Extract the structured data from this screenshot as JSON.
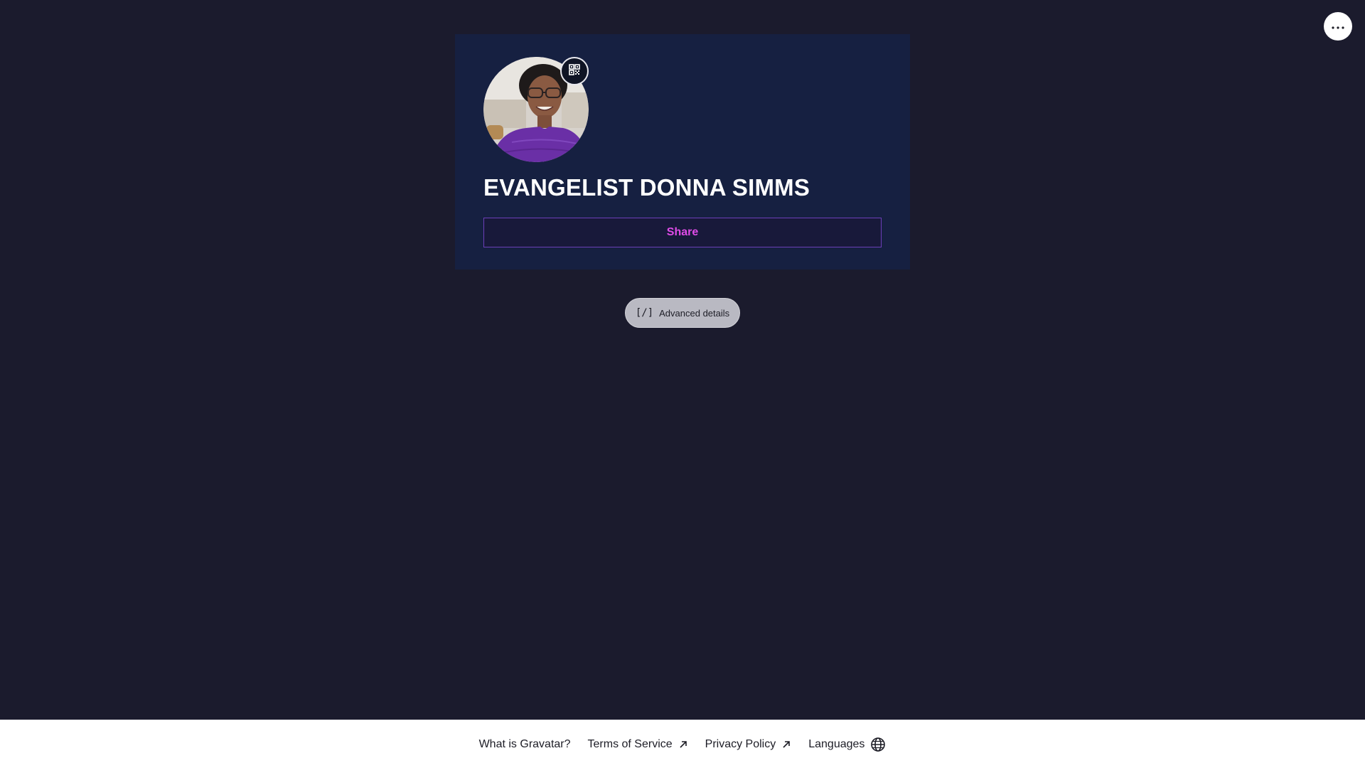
{
  "profile": {
    "name": "EVANGELIST DONNA SIMMS"
  },
  "card": {
    "share_label": "Share"
  },
  "advanced": {
    "label": "Advanced details",
    "icon_text": "[/]"
  },
  "footer": {
    "links": [
      {
        "label": "What is Gravatar?"
      },
      {
        "label": "Terms of Service"
      },
      {
        "label": "Privacy Policy"
      },
      {
        "label": "Languages"
      }
    ]
  },
  "colors": {
    "background": "#1b1b2d",
    "card": "#162041",
    "accent": "#e04ce8",
    "share_border": "#6b3fb8"
  },
  "icons": {
    "more": "ellipsis-icon",
    "qr": "qr-code-icon",
    "external": "arrow-up-right-icon",
    "languages": "globe-icon"
  }
}
